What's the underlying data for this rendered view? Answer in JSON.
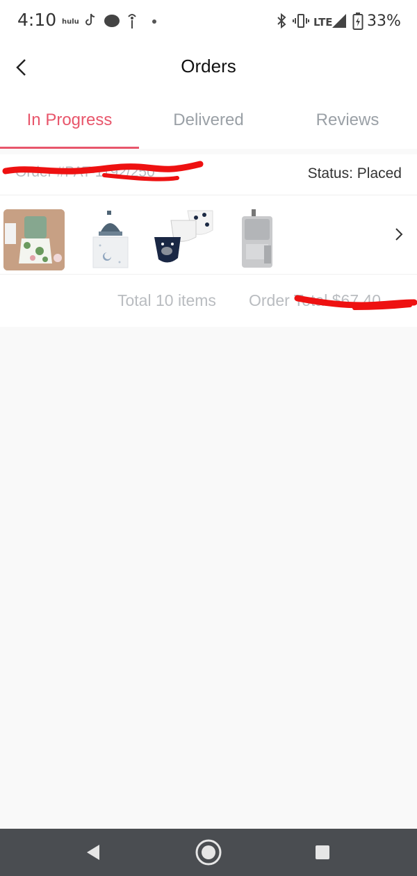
{
  "status_bar": {
    "time": "4:10",
    "app_label": "hulu",
    "battery": "33%",
    "network": "LTE",
    "icons": [
      "hulu-icon",
      "tiktok-icon",
      "cloud-icon",
      "signal-info-icon",
      "dot-icon",
      "bluetooth-icon",
      "vibrate-icon",
      "cell-signal-icon",
      "battery-charging-icon"
    ]
  },
  "header": {
    "title": "Orders",
    "back_icon": "chevron-left-icon"
  },
  "tabs": [
    {
      "label": "In Progress",
      "active": true
    },
    {
      "label": "Delivered",
      "active": false
    },
    {
      "label": "Reviews",
      "active": false
    }
  ],
  "order": {
    "order_id": "Order #PAT-1192/250",
    "status": "Status: Placed",
    "items": [
      {
        "name": "Green floral romper outfit"
      },
      {
        "name": "Hat and swaddle blanket set"
      },
      {
        "name": "Handsome bandana bib set"
      },
      {
        "name": "Grey hanging diaper organizer"
      }
    ],
    "total_items": "Total 10 items",
    "order_total": "Order Total $67.40"
  },
  "colors": {
    "accent": "#e8566b",
    "muted_text": "#9aa0a6",
    "nav_bar": "#4a4d51",
    "redaction": "#ee1111"
  },
  "nav": {
    "icons": [
      "back-triangle-icon",
      "home-circle-icon",
      "recents-square-icon"
    ]
  }
}
